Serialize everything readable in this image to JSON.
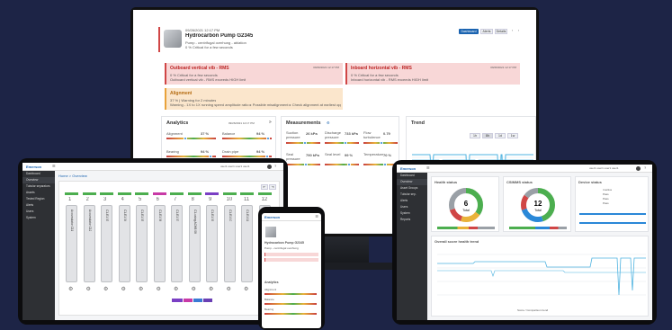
{
  "colors": {
    "background": "#1d2446",
    "alarm_red": "#d04646",
    "warn_orange": "#e9a23a",
    "ok_green": "#4cae4f",
    "accent_blue": "#1a63b0",
    "trend_cyan": "#4fb3e0"
  },
  "monitor": {
    "asset": {
      "timestamp": "09/26/2021 12:17 PM",
      "title": "Hydrocarbon Pump G2345",
      "subtitle": "Pump - centrifugal overhung - ablation",
      "status_line": "0 % Critical for a few seconds"
    },
    "header_buttons": [
      {
        "label": "Dashboard"
      },
      {
        "label": "Alerts"
      },
      {
        "label": "Details"
      }
    ],
    "alerts": [
      {
        "title": "Outboard vertical vib - RMS",
        "time": "09/26/2021 12:17 PM",
        "line1": "0 % Critical for a few seconds",
        "line2": "Outboard vertical vib - RMS exceeds HIGH limit"
      },
      {
        "title": "Inboard horizontal vib - RMS",
        "time": "09/26/2021 12:17 PM",
        "line1": "0 % Critical for a few seconds",
        "line2": "Inboard horizontal vib - RMS exceeds HIGH limit"
      },
      {
        "title": "Alignment",
        "time": "",
        "line1": "37 % | Warning for 2 minutes",
        "line2": "Warning - 1X to 1X running speed amplitude ratio ▸ Possible misalignment ▸ Check alignment at earliest opportunity"
      }
    ],
    "analytics": {
      "title": "Analytics",
      "time": "09/26/2021 12:17 PM",
      "items": [
        {
          "label": "Alignment",
          "value": "37 %",
          "pos": 0.37
        },
        {
          "label": "Balance",
          "value": "94 %",
          "pos": 0.94
        },
        {
          "label": "Bearing",
          "value": "94 %",
          "pos": 0.9
        },
        {
          "label": "Drain pipe",
          "value": "94 %",
          "pos": 0.92
        }
      ]
    },
    "measurements": {
      "title": "Measurements",
      "items": [
        {
          "label": "Suction pressure",
          "value": "26 kPa",
          "pos": 0.55
        },
        {
          "label": "Discharge pressure",
          "value": "733 kPa",
          "pos": 0.6
        },
        {
          "label": "Flow turbulence",
          "value": "0.79",
          "pos": 0.5
        },
        {
          "label": "Seal pressure",
          "value": "790 kPa",
          "pos": 0.58
        },
        {
          "label": "Seal level",
          "value": "99 %",
          "pos": 0.7
        },
        {
          "label": "Temperature",
          "value": "70 %",
          "pos": 0.62
        }
      ]
    },
    "trend": {
      "title": "Trend",
      "ranges": [
        "1h",
        "8h",
        "1d",
        "1w"
      ]
    }
  },
  "tablet_left": {
    "header": "Emerson",
    "user": "user1 user1 user1 user1",
    "breadcrumb": "Home > Overview",
    "sidebar": [
      "Dashboard",
      "Overview",
      "Tubular separators",
      "Assets",
      "Tested Region",
      "Alerts",
      "Users",
      "System"
    ],
    "tubes": [
      {
        "num": "1",
        "label": "Accumulator C11"
      },
      {
        "num": "2",
        "label": "Accumulator C12"
      },
      {
        "num": "3",
        "label": "C1-E1 03"
      },
      {
        "num": "4",
        "label": "C1-E1 04"
      },
      {
        "num": "5",
        "label": "C1-E1 05"
      },
      {
        "num": "6",
        "label": "C1-E1 06"
      },
      {
        "num": "7",
        "label": "C1-E1 07"
      },
      {
        "num": "8",
        "label": "C1-using ACHB 08"
      },
      {
        "num": "9",
        "label": "C1-E1 09"
      },
      {
        "num": "10",
        "label": "C1-E1 10"
      },
      {
        "num": "11",
        "label": "C1-E1 11"
      },
      {
        "num": "12",
        "label": "C1-E1 12"
      }
    ]
  },
  "phone": {
    "brand": "Emerson",
    "card_title": "Hydrocarbon Pump G2345",
    "card_sub": "Pump - centrifugal overhung",
    "section": "Analytics",
    "items": [
      "Alignment",
      "Balance",
      "Bearing"
    ]
  },
  "tablet_right": {
    "header": "Emerson",
    "user": "user1 user1 user1 user1",
    "sidebar": [
      "Dashboard",
      "Overview",
      "Asset Groups",
      "Tubular sep.",
      "Alerts",
      "Users",
      "System",
      "Reports"
    ],
    "donut1": {
      "title": "Health status",
      "center_value": "6",
      "center_label": "Total",
      "segments": [
        0.35,
        0.2,
        0.15,
        0.3
      ]
    },
    "donut2": {
      "title": "CSIMMS status",
      "center_value": "12",
      "center_label": "Total",
      "segments": [
        0.45,
        0.25,
        0.15,
        0.15
      ]
    },
    "status_panel": {
      "title": "Device status",
      "rows": [
        "4 active",
        "Pass",
        "Pass",
        "Pass"
      ]
    },
    "trend": {
      "title": "Overall score health trend",
      "legend": "Score / Comparison trend"
    }
  }
}
